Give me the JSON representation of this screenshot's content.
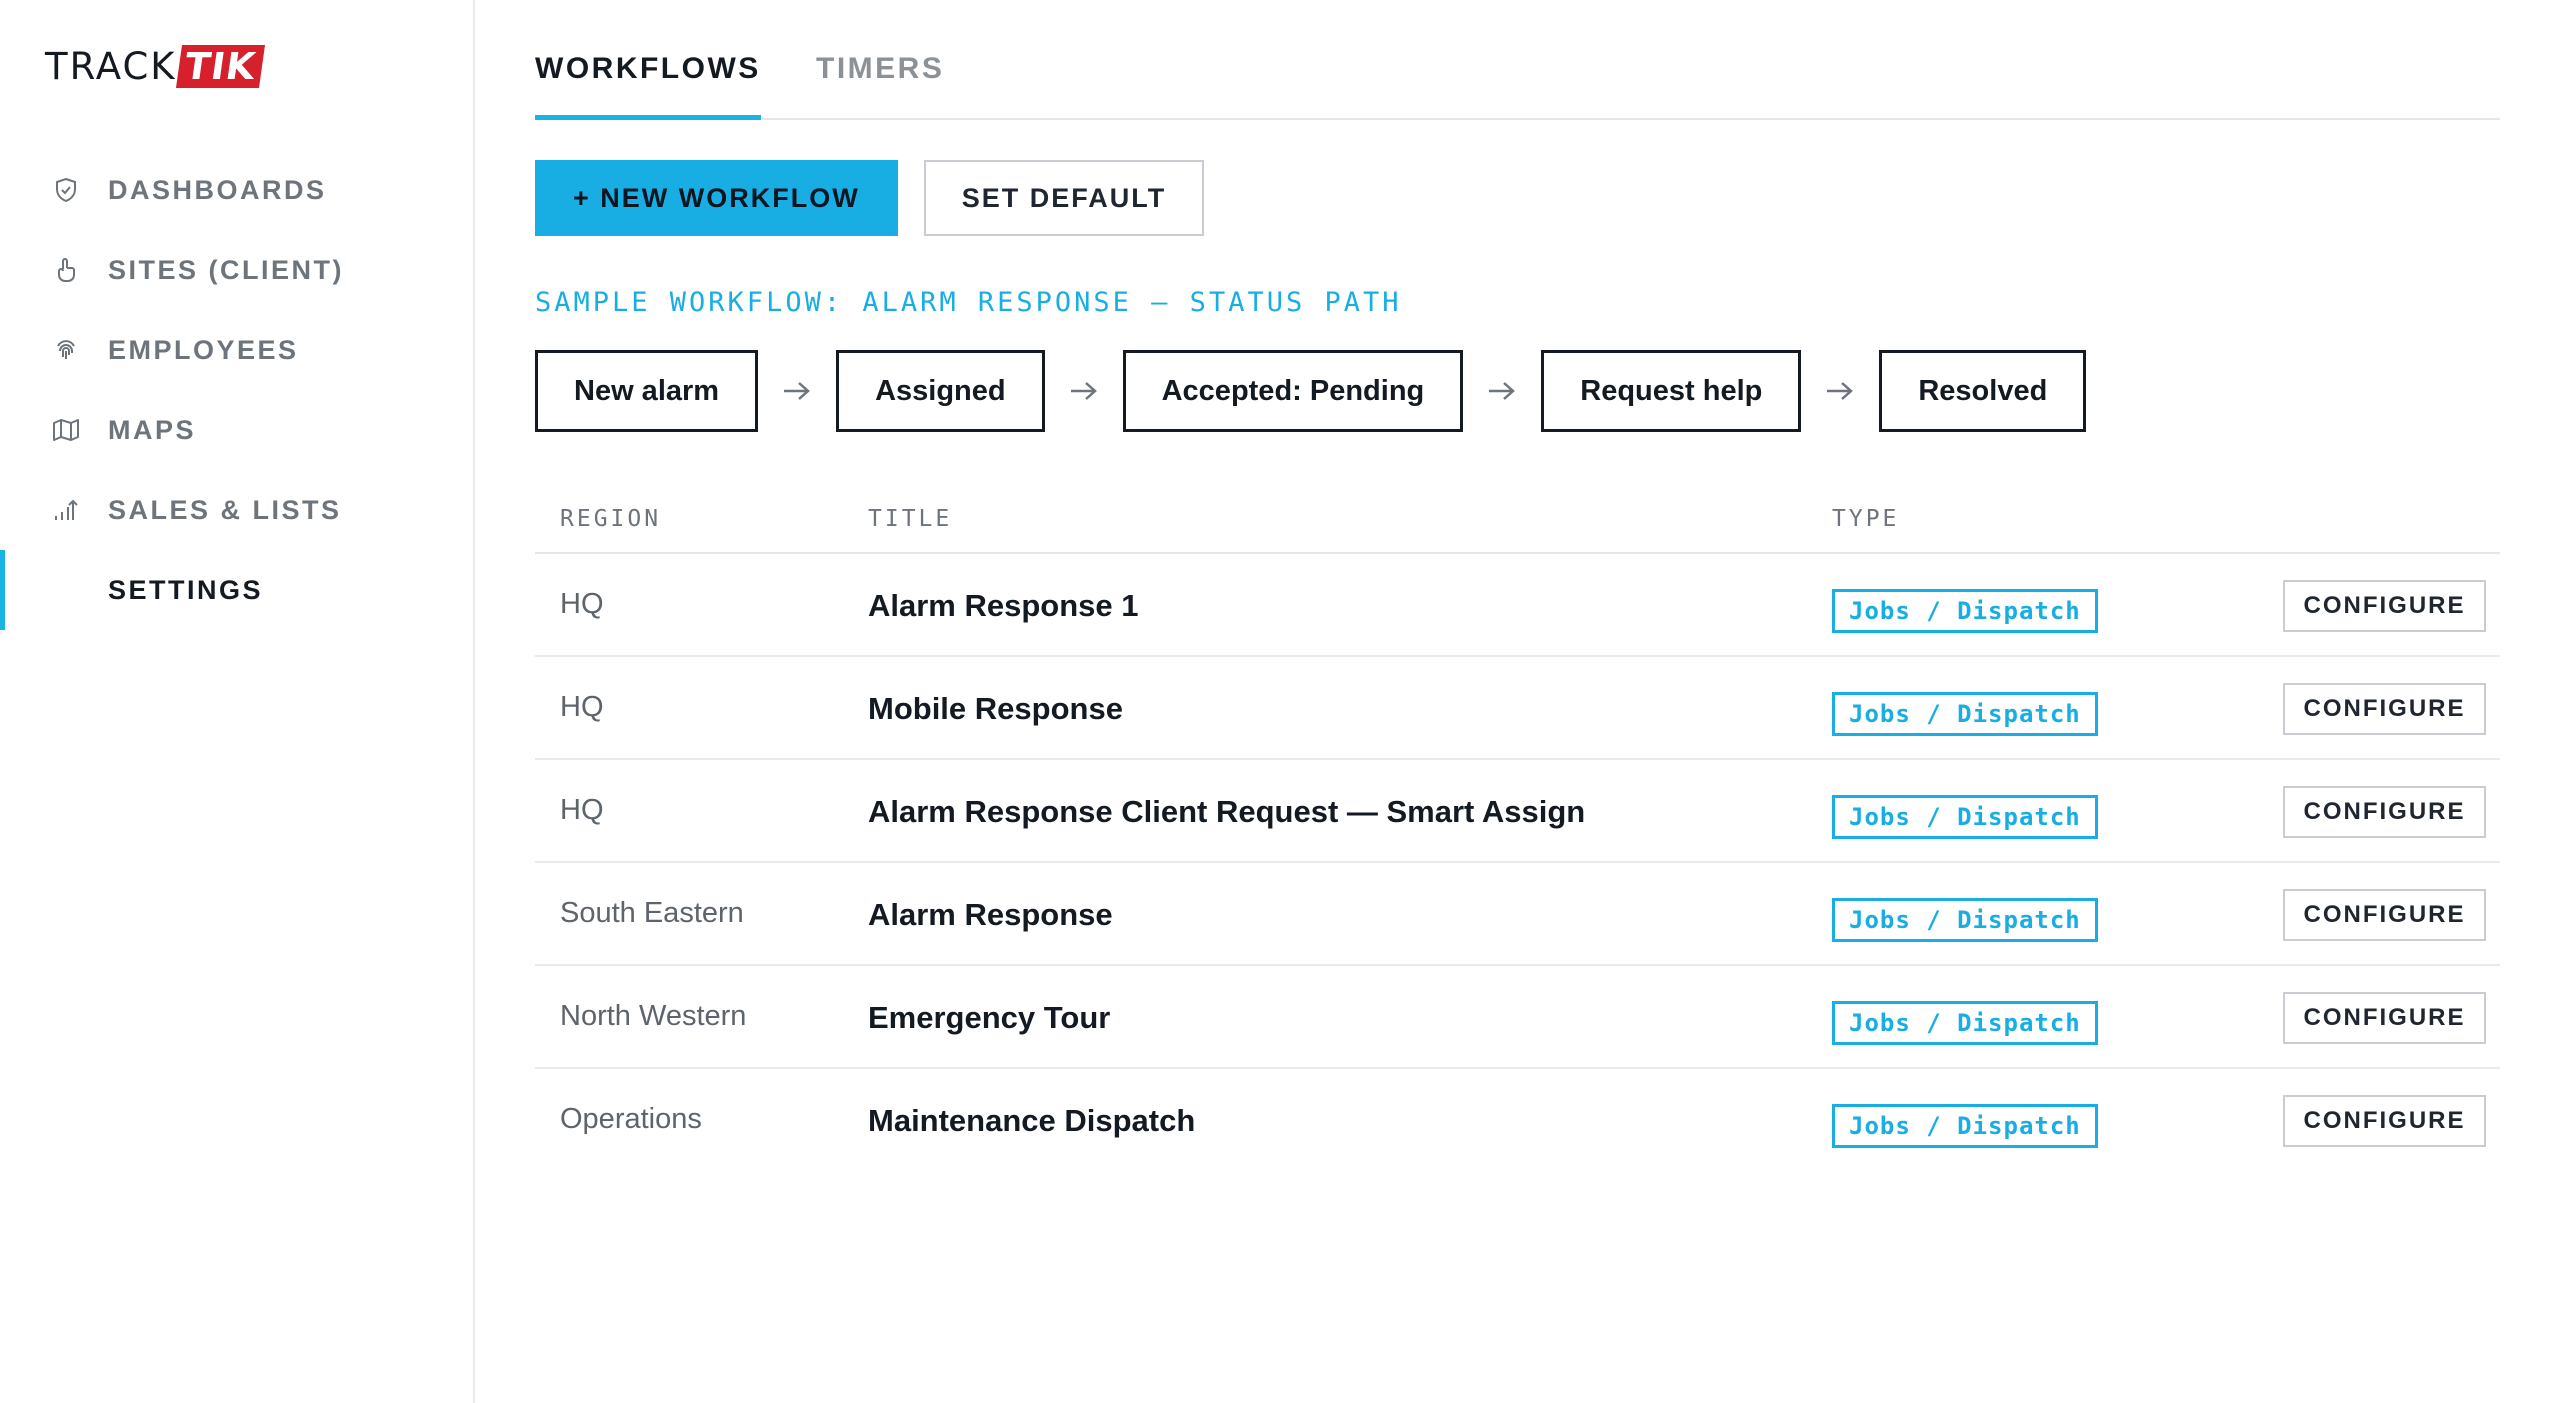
{
  "brand": {
    "part1": "TRACK",
    "part2": "TIK"
  },
  "sidebar": {
    "items": [
      {
        "label": "DASHBOARDS",
        "icon": "shield-icon",
        "active": false
      },
      {
        "label": "SITES (CLIENT)",
        "icon": "hand-icon",
        "active": false
      },
      {
        "label": "EMPLOYEES",
        "icon": "fingerprint-icon",
        "active": false
      },
      {
        "label": "MAPS",
        "icon": "map-icon",
        "active": false
      },
      {
        "label": "SALES & LISTS",
        "icon": "chart-up-icon",
        "active": false
      },
      {
        "label": "SETTINGS",
        "icon": "",
        "active": true
      }
    ]
  },
  "tabs": [
    {
      "label": "WORKFLOWS",
      "active": true
    },
    {
      "label": "TIMERS",
      "active": false
    }
  ],
  "actions": {
    "new_workflow": "+ NEW WORKFLOW",
    "set_default": "SET DEFAULT"
  },
  "sample": {
    "title": "SAMPLE WORKFLOW: ALARM RESPONSE — STATUS PATH",
    "steps": [
      "New alarm",
      "Assigned",
      "Accepted: Pending",
      "Request help",
      "Resolved"
    ]
  },
  "table": {
    "headers": {
      "region": "REGION",
      "title": "TITLE",
      "type": "TYPE"
    },
    "configure_label": "CONFIGURE",
    "rows": [
      {
        "region": "HQ",
        "title": "Alarm Response 1",
        "type": "Jobs / Dispatch"
      },
      {
        "region": "HQ",
        "title": "Mobile Response",
        "type": "Jobs / Dispatch"
      },
      {
        "region": "HQ",
        "title": "Alarm Response Client Request — Smart Assign",
        "type": "Jobs / Dispatch"
      },
      {
        "region": "South Eastern",
        "title": "Alarm Response",
        "type": "Jobs / Dispatch"
      },
      {
        "region": "North Western",
        "title": "Emergency Tour",
        "type": "Jobs / Dispatch"
      },
      {
        "region": "Operations",
        "title": "Maintenance Dispatch",
        "type": "Jobs / Dispatch"
      }
    ]
  },
  "colors": {
    "accent": "#19aee3",
    "brand_red": "#d6202c",
    "text_dark": "#141a22",
    "text_muted": "#6d747c"
  }
}
